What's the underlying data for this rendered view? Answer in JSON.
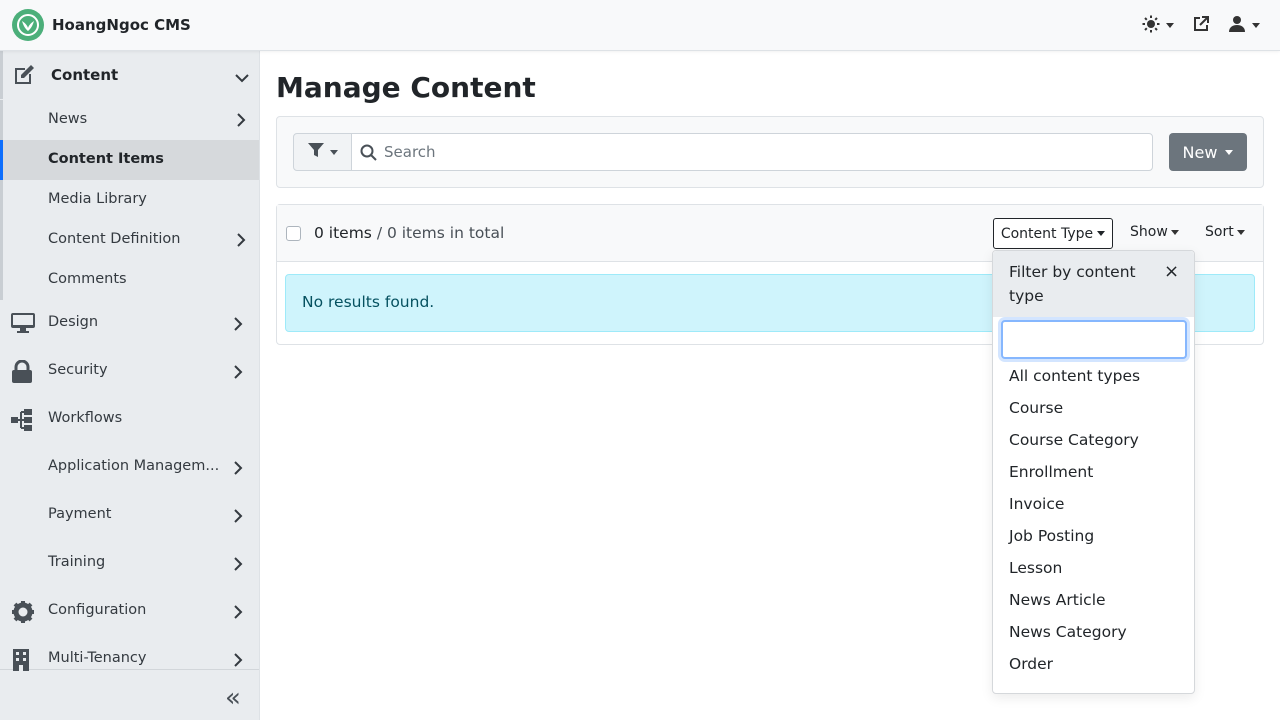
{
  "app": {
    "name": "HoangNgoc CMS"
  },
  "navbar": {
    "theme_icon": "sun-icon",
    "external_icon": "external-link-icon",
    "user_icon": "user-icon"
  },
  "sidebar": {
    "content": {
      "label": "Content",
      "children": [
        "News",
        "Content Items",
        "Media Library",
        "Content Definition",
        "Comments"
      ]
    },
    "items": [
      "Design",
      "Security",
      "Workflows",
      "Application Managem...",
      "Payment",
      "Training",
      "Configuration",
      "Multi-Tenancy"
    ],
    "collapse": "«"
  },
  "main": {
    "title": "Manage Content",
    "search": {
      "placeholder": "Search",
      "value": ""
    },
    "new_label": "New",
    "list": {
      "count": "0 items",
      "total": " / 0 items in total",
      "content_type": "Content Type",
      "show": "Show",
      "sort": "Sort",
      "empty": "No results found."
    }
  },
  "dropdown": {
    "title": "Filter by content type",
    "close": "×",
    "filter_value": "",
    "options": [
      "All content types",
      "Course",
      "Course Category",
      "Enrollment",
      "Invoice",
      "Job Posting",
      "Lesson",
      "News Article",
      "News Category",
      "Order"
    ]
  },
  "colors": {
    "accent": "#0d6efd",
    "new_button": "#6c757d",
    "alert_bg": "#cff4fc",
    "alert_text": "#055160",
    "logo": "#4caf7a"
  }
}
